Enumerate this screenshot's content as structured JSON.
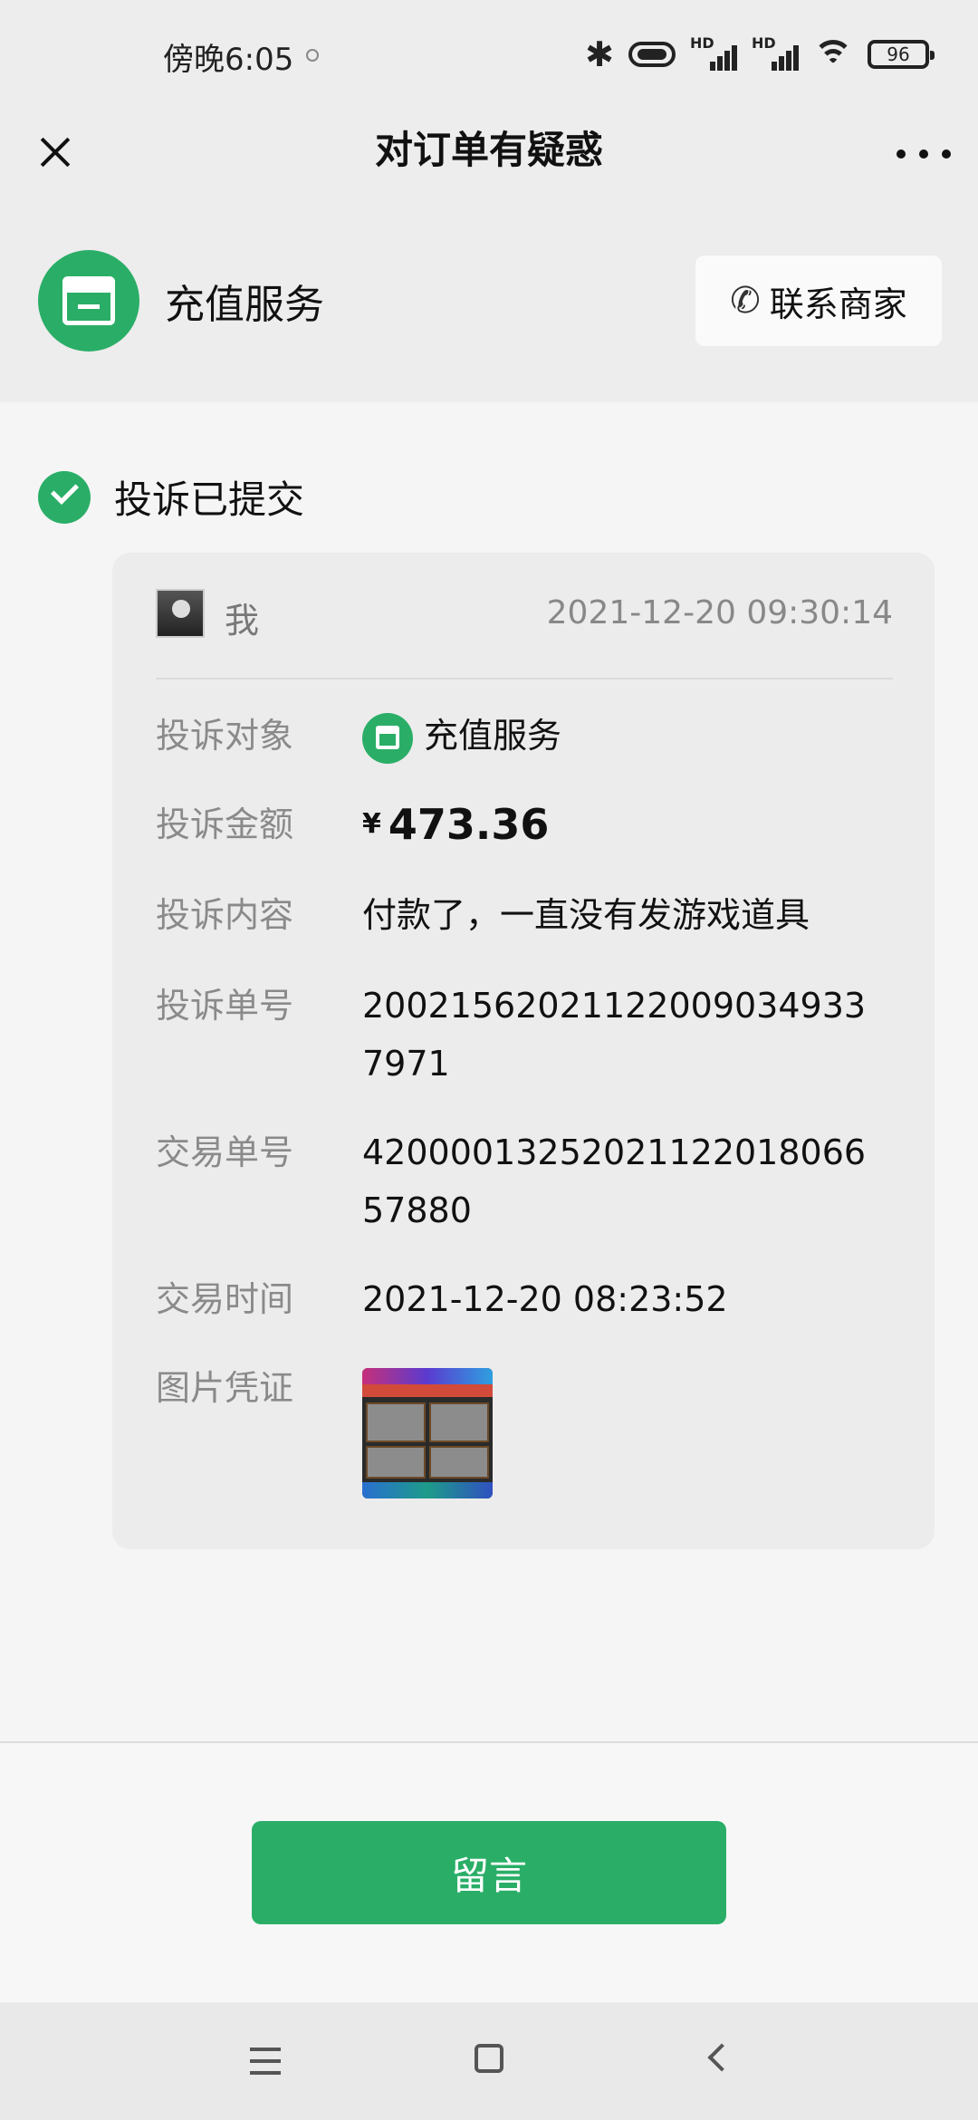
{
  "status_bar": {
    "time": "傍晚6:05",
    "battery": "96",
    "signal_label_1": "HD",
    "signal_label_2": "HD"
  },
  "nav": {
    "title": "对订单有疑惑"
  },
  "merchant": {
    "name": "充值服务",
    "contact_label": "联系商家"
  },
  "complaint": {
    "status": "投诉已提交",
    "author": "我",
    "submitted_at": "2021-12-20 09:30:14",
    "rows": {
      "target_label": "投诉对象",
      "target_value": "充值服务",
      "amount_label": "投诉金额",
      "currency": "¥",
      "amount_value": "473.36",
      "content_label": "投诉内容",
      "content_value": "付款了，一直没有发游戏道具",
      "complaint_no_label": "投诉单号",
      "complaint_no_value": "200215620211220090349337971",
      "trade_no_label": "交易单号",
      "trade_no_value": "4200001325202112201806657880",
      "trade_time_label": "交易时间",
      "trade_time_value": "2021-12-20 08:23:52",
      "evidence_label": "图片凭证"
    }
  },
  "actions": {
    "leave_message": "留言"
  },
  "colors": {
    "accent": "#2aae67",
    "background": "#f5f5f5",
    "header_bg": "#ededed"
  }
}
